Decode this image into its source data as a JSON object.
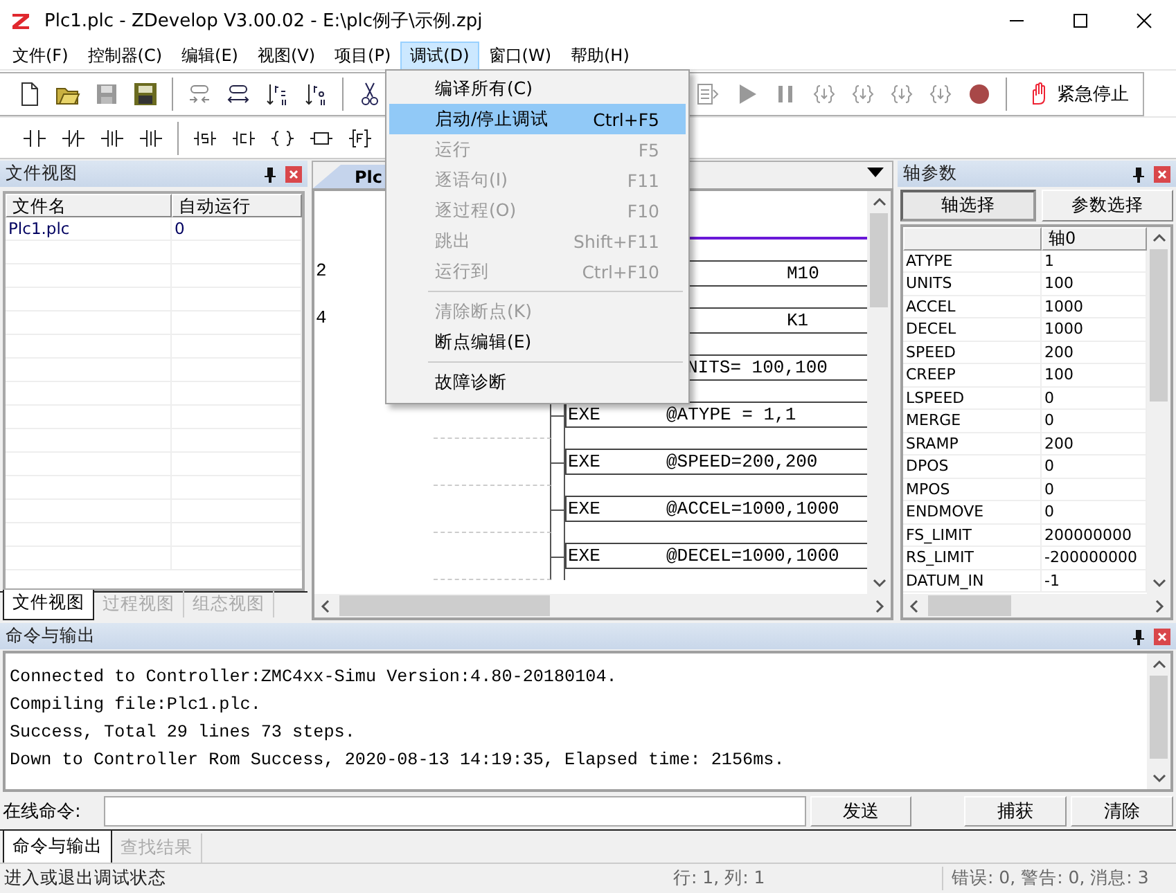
{
  "window": {
    "title": "Plc1.plc - ZDevelop V3.00.02 - E:\\plc例子\\示例.zpj"
  },
  "menu_bar": [
    {
      "label": "文件(F)",
      "selected": false
    },
    {
      "label": "控制器(C)",
      "selected": false
    },
    {
      "label": "编辑(E)",
      "selected": false
    },
    {
      "label": "视图(V)",
      "selected": false
    },
    {
      "label": "项目(P)",
      "selected": false
    },
    {
      "label": "调试(D)",
      "selected": true
    },
    {
      "label": "窗口(W)",
      "selected": false
    },
    {
      "label": "帮助(H)",
      "selected": false
    }
  ],
  "debug_menu": [
    {
      "kind": "item",
      "label": "编译所有(C)",
      "disabled": false,
      "selected": false
    },
    {
      "kind": "item",
      "label": "启动/停止调试",
      "shortcut": "Ctrl+F5",
      "disabled": false,
      "selected": true
    },
    {
      "kind": "item",
      "label": "运行",
      "shortcut": "F5",
      "disabled": true,
      "selected": false
    },
    {
      "kind": "item",
      "label": "逐语句(I)",
      "shortcut": "F11",
      "disabled": true,
      "selected": false
    },
    {
      "kind": "item",
      "label": "逐过程(O)",
      "shortcut": "F10",
      "disabled": true,
      "selected": false
    },
    {
      "kind": "item",
      "label": "跳出",
      "shortcut": "Shift+F11",
      "disabled": true,
      "selected": false
    },
    {
      "kind": "item",
      "label": "运行到",
      "shortcut": "Ctrl+F10",
      "disabled": true,
      "selected": false
    },
    {
      "kind": "separator"
    },
    {
      "kind": "item",
      "label": "清除断点(K)",
      "disabled": true,
      "selected": false
    },
    {
      "kind": "item",
      "label": "断点编辑(E)",
      "disabled": false,
      "selected": false
    },
    {
      "kind": "separator"
    },
    {
      "kind": "item",
      "label": "故障诊断",
      "disabled": false,
      "selected": false
    }
  ],
  "toolbar": {
    "emergency_stop": "紧急停止"
  },
  "file_view": {
    "title": "文件视图",
    "columns": [
      "文件名",
      "自动运行"
    ],
    "rows": [
      [
        "Plc1.plc",
        "0"
      ]
    ],
    "tabs": [
      {
        "label": "文件视图",
        "selected": true
      },
      {
        "label": "过程视图",
        "selected": false
      },
      {
        "label": "组态视图",
        "selected": false
      }
    ]
  },
  "editor": {
    "tab": "Plc",
    "rungs": [
      {
        "kind": "contact",
        "line": "2",
        "argument": "M10"
      },
      {
        "kind": "contact",
        "line": "4",
        "argument": "K1"
      },
      {
        "kind": "partial",
        "argument": "NITS= 100,100"
      },
      {
        "kind": "exe",
        "instruction": "EXE",
        "argument": "@ATYPE = 1,1"
      },
      {
        "kind": "exe",
        "instruction": "EXE",
        "argument": "@SPEED=200,200"
      },
      {
        "kind": "exe",
        "instruction": "EXE",
        "argument": "@ACCEL=1000,1000"
      },
      {
        "kind": "exe",
        "instruction": "EXE",
        "argument": "@DECEL=1000,1000"
      }
    ]
  },
  "axis_params": {
    "title": "轴参数",
    "buttons": [
      {
        "label": "轴选择",
        "selected": true
      },
      {
        "label": "参数选择",
        "selected": false
      }
    ],
    "column": "轴0",
    "rows": [
      {
        "name": "ATYPE",
        "value": "1"
      },
      {
        "name": "UNITS",
        "value": "100"
      },
      {
        "name": "ACCEL",
        "value": "1000"
      },
      {
        "name": "DECEL",
        "value": "1000"
      },
      {
        "name": "SPEED",
        "value": "200"
      },
      {
        "name": "CREEP",
        "value": "100"
      },
      {
        "name": "LSPEED",
        "value": "0"
      },
      {
        "name": "MERGE",
        "value": "0"
      },
      {
        "name": "SRAMP",
        "value": "200"
      },
      {
        "name": "DPOS",
        "value": "0"
      },
      {
        "name": "MPOS",
        "value": "0"
      },
      {
        "name": "ENDMOVE",
        "value": "0"
      },
      {
        "name": "FS_LIMIT",
        "value": "200000000"
      },
      {
        "name": "RS_LIMIT",
        "value": "-200000000"
      },
      {
        "name": "DATUM_IN",
        "value": "-1"
      }
    ]
  },
  "output": {
    "title": "命令与输出",
    "lines": [
      "Connected to Controller:ZMC4xx-Simu Version:4.80-20180104.",
      "Compiling file:Plc1.plc.",
      "Success, Total 29 lines 73 steps.",
      "Down to Controller Rom Success, 2020-08-13 14:19:35, Elapsed time: 2156ms."
    ],
    "command_label": "在线命令:",
    "buttons": [
      "发送",
      "捕获",
      "清除"
    ],
    "tabs": [
      {
        "label": "命令与输出",
        "selected": true
      },
      {
        "label": "查找结果",
        "selected": false
      }
    ]
  },
  "status_bar": {
    "message": "进入或退出调试状态",
    "position": "行: 1, 列: 1",
    "counts": "错误: 0, 警告: 0, 消息: 3"
  }
}
